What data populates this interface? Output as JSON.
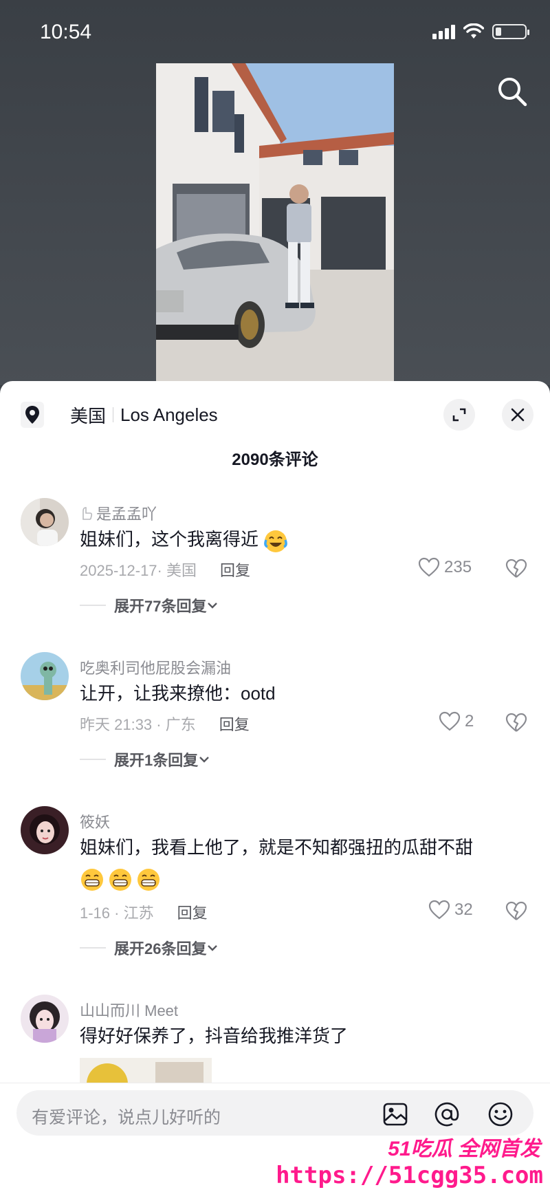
{
  "status": {
    "time": "10:54"
  },
  "location": {
    "country": "美国",
    "city": "Los Angeles"
  },
  "comments_title": "2090条评论",
  "comments": [
    {
      "name": "是孟孟吖",
      "text": "姐妹们，这个我离得近",
      "date": "2025-12-17· 美国",
      "reply": "回复",
      "likes": "235",
      "expand": "展开77条回复",
      "emoji": "laugh-cry"
    },
    {
      "name": "吃奥利司他屁股会漏油",
      "text": "让开，让我来撩他：ootd",
      "date": "昨天 21:33 · 广东",
      "reply": "回复",
      "likes": "2",
      "expand": "展开1条回复"
    },
    {
      "name": "筱妖",
      "text": "姐妹们，我看上他了，就是不知都强扭的瓜甜不甜",
      "date": "1-16 · 江苏",
      "reply": "回复",
      "likes": "32",
      "expand": "展开26条回复",
      "emoji": "grin",
      "emoji_count": 3
    },
    {
      "name": "山山而川 Meet",
      "text": "得好好保养了，抖音给我推洋货了"
    }
  ],
  "input": {
    "placeholder": "有爱评论，说点儿好听的"
  },
  "watermark": {
    "line1": "51吃瓜 全网首发",
    "line2": "https://51cgg35.com"
  },
  "colors": {
    "accent": "#ff1a8c",
    "panel_bg": "#ffffff",
    "video_bg": "#3d4248"
  }
}
